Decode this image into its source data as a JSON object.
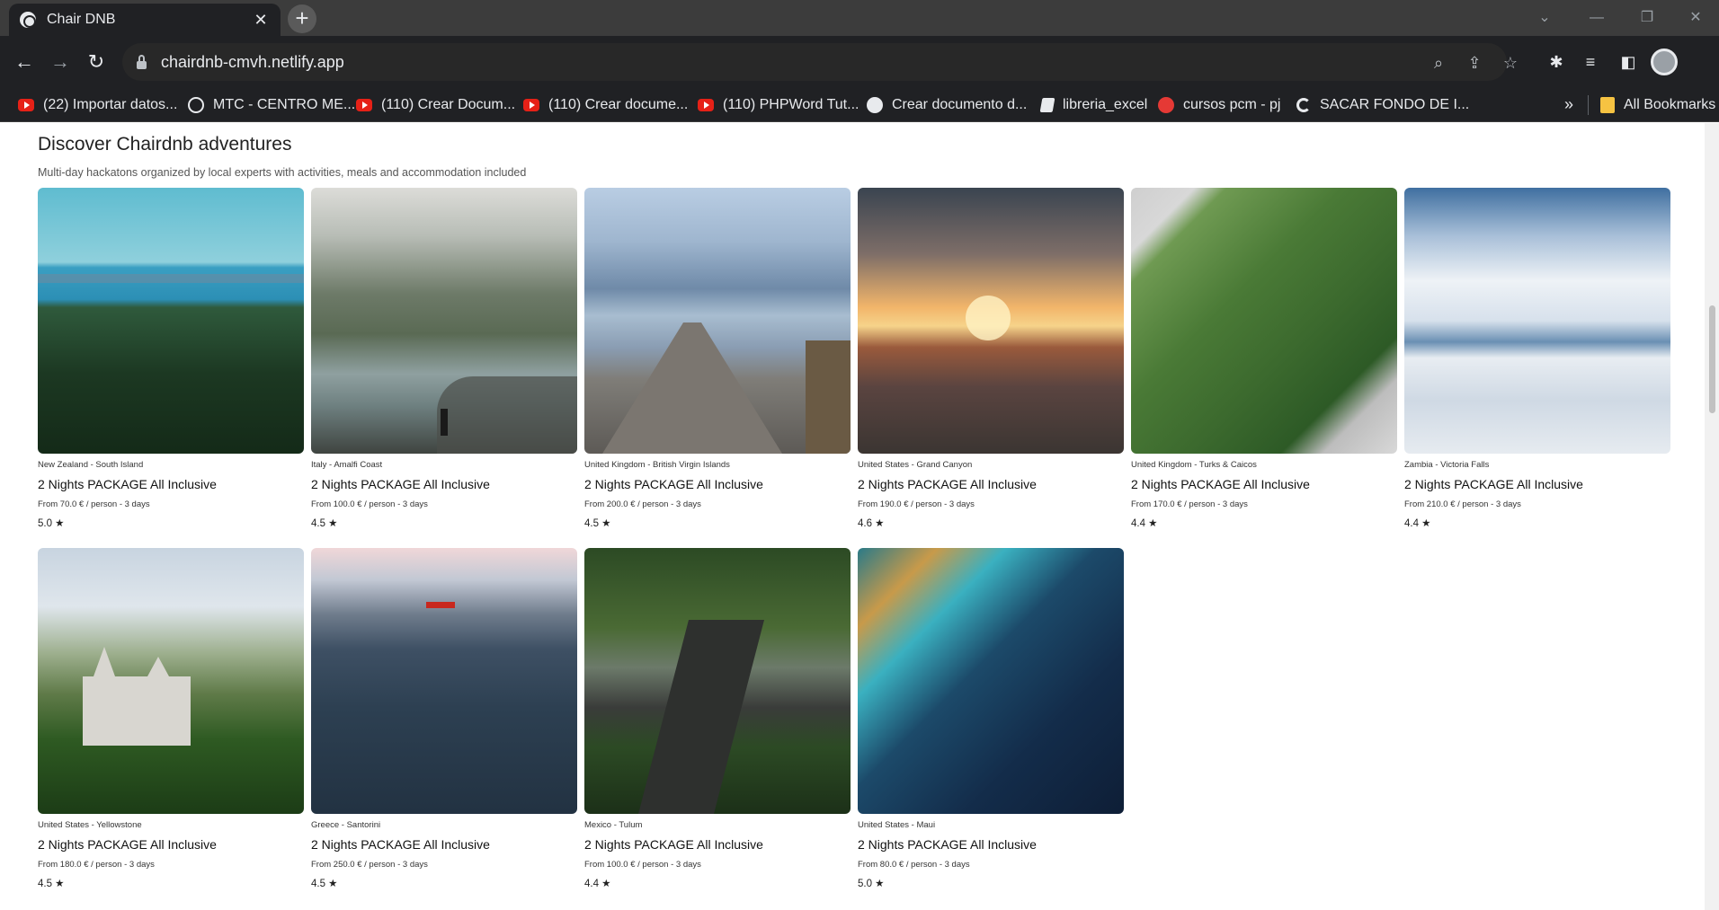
{
  "browser": {
    "tab_title": "Chair DNB",
    "url": "chairdnb-cmvh.netlify.app",
    "bookmarks": [
      {
        "label": "(22) Importar datos...",
        "icon": "youtube-icon"
      },
      {
        "label": "MTC - CENTRO ME...",
        "icon": "globe-icon"
      },
      {
        "label": "(110) Crear Docum...",
        "icon": "youtube-icon"
      },
      {
        "label": "(110) Crear docume...",
        "icon": "youtube-icon"
      },
      {
        "label": "(110) PHPWord Tut...",
        "icon": "youtube-icon"
      },
      {
        "label": "Crear documento d...",
        "icon": "wordpress-icon"
      },
      {
        "label": "libreria_excel",
        "icon": "document-icon"
      },
      {
        "label": "cursos pcm - pj",
        "icon": "pcm-icon"
      },
      {
        "label": "SACAR FONDO DE I...",
        "icon": "c-icon"
      }
    ],
    "more_bookmarks": "»",
    "all_bookmarks": "All Bookmarks"
  },
  "page": {
    "title": "Discover Chairdnb adventures",
    "subtitle": "Multi-day hackatons organized by local experts with activities, meals and accommodation included",
    "cards": [
      {
        "location": "New Zealand - South Island",
        "title": "2 Nights PACKAGE All Inclusive",
        "price": "From 70.0 € / person - 3 days",
        "rating": "5.0 ★"
      },
      {
        "location": "Italy - Amalfi Coast",
        "title": "2 Nights PACKAGE All Inclusive",
        "price": "From 100.0 € / person - 3 days",
        "rating": "4.5 ★"
      },
      {
        "location": "United Kingdom - British Virgin Islands",
        "title": "2 Nights PACKAGE All Inclusive",
        "price": "From 200.0 € / person - 3 days",
        "rating": "4.5 ★"
      },
      {
        "location": "United States - Grand Canyon",
        "title": "2 Nights PACKAGE All Inclusive",
        "price": "From 190.0 € / person - 3 days",
        "rating": "4.6 ★"
      },
      {
        "location": "United Kingdom - Turks & Caicos",
        "title": "2 Nights PACKAGE All Inclusive",
        "price": "From 170.0 € / person - 3 days",
        "rating": "4.4 ★"
      },
      {
        "location": "Zambia - Victoria Falls",
        "title": "2 Nights PACKAGE All Inclusive",
        "price": "From 210.0 € / person - 3 days",
        "rating": "4.4 ★"
      },
      {
        "location": "United States - Yellowstone",
        "title": "2 Nights PACKAGE All Inclusive",
        "price": "From 180.0 € / person - 3 days",
        "rating": "4.5 ★"
      },
      {
        "location": "Greece - Santorini",
        "title": "2 Nights PACKAGE All Inclusive",
        "price": "From 250.0 € / person - 3 days",
        "rating": "4.5 ★"
      },
      {
        "location": "Mexico - Tulum",
        "title": "2 Nights PACKAGE All Inclusive",
        "price": "From 100.0 € / person - 3 days",
        "rating": "4.4 ★"
      },
      {
        "location": "United States - Maui",
        "title": "2 Nights PACKAGE All Inclusive",
        "price": "From 80.0 € / person - 3 days",
        "rating": "5.0 ★"
      }
    ]
  }
}
